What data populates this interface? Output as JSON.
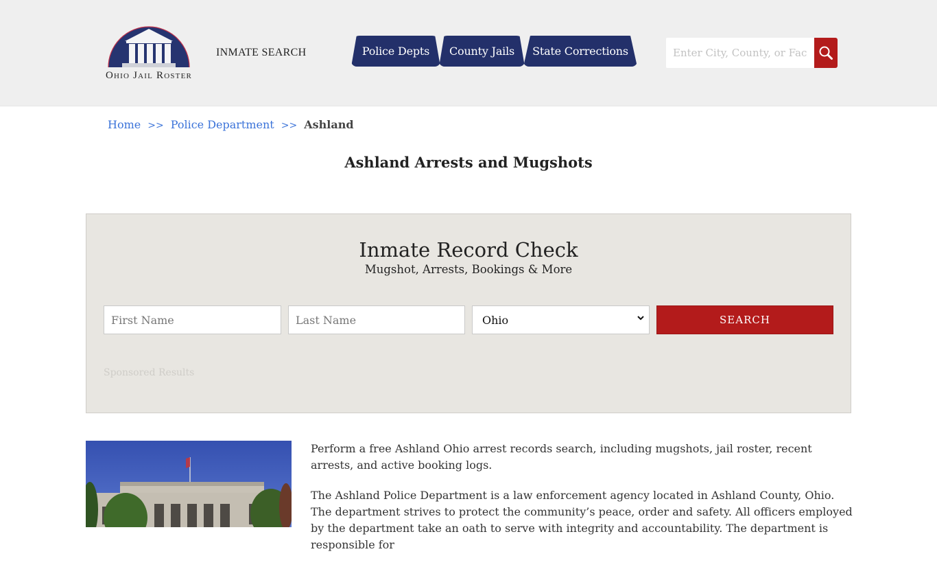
{
  "header": {
    "logo": {
      "text": "Ohio Jail Roster",
      "icon": "courthouse-dome-icon"
    },
    "inmate_search_label": "INMATE SEARCH",
    "nav_tabs": [
      {
        "label": "Police Depts"
      },
      {
        "label": "County Jails"
      },
      {
        "label": "State Corrections"
      }
    ],
    "search": {
      "placeholder": "Enter City, County, or Facility",
      "value": "",
      "button_icon": "search-icon"
    },
    "colors": {
      "nav_bg": "#23306a",
      "accent_red": "#b31b1b",
      "header_bg": "#efefef"
    }
  },
  "breadcrumb": {
    "items": [
      {
        "label": "Home"
      },
      {
        "label": "Police Department"
      },
      {
        "label": "Ashland"
      }
    ],
    "separator": ">>"
  },
  "page_title": "Ashland Arrests and Mugshots",
  "record_check": {
    "title": "Inmate Record Check",
    "subtitle": "Mugshot, Arrests, Bookings & More",
    "first_name": {
      "placeholder": "First Name",
      "value": ""
    },
    "last_name": {
      "placeholder": "Last Name",
      "value": ""
    },
    "state": {
      "selected": "Ohio"
    },
    "search_label": "SEARCH",
    "sponsored_label": "Sponsored Results"
  },
  "content": {
    "image_alt": "Ashland County Court House",
    "paragraphs": [
      "Perform a free Ashland Ohio arrest records search, including mugshots, jail roster, recent arrests, and active booking logs.",
      "The Ashland Police Department is a law enforcement agency located in Ashland County, Ohio. The department strives to protect the community’s peace, order and safety. All officers employed by the department take an oath to serve with integrity and accountability. The department is responsible for"
    ]
  }
}
